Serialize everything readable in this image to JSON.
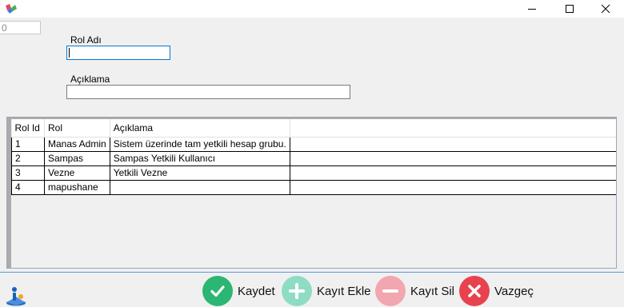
{
  "window": {
    "controls": [
      "minimize-icon",
      "maximize-icon",
      "close-icon"
    ]
  },
  "form": {
    "id_value": "0",
    "rol_adi_label": "Rol Adı",
    "rol_adi_value": "",
    "aciklama_label": "Açıklama",
    "aciklama_value": ""
  },
  "grid": {
    "columns": [
      "Rol Id",
      "Rol",
      "Açıklama"
    ],
    "rows": [
      {
        "id": "1",
        "rol": "Manas Admin",
        "aciklama": "Sistem üzerinde tam yetkili hesap grubu."
      },
      {
        "id": "2",
        "rol": "Sampas",
        "aciklama": "Sampas Yetkili Kullanıcı"
      },
      {
        "id": "3",
        "rol": "Vezne",
        "aciklama": "Yetkili Vezne"
      },
      {
        "id": "4",
        "rol": "mapushane",
        "aciklama": ""
      }
    ]
  },
  "actions": {
    "save": {
      "label": "Kaydet",
      "icon": "check-icon",
      "color": "#2bb673"
    },
    "add": {
      "label": "Kayıt Ekle",
      "icon": "plus-icon",
      "color": "#8fdcc4"
    },
    "delete": {
      "label": "Kayıt Sil",
      "icon": "minus-icon",
      "color": "#f2a6b0"
    },
    "cancel": {
      "label": "Vazgeç",
      "icon": "x-icon",
      "color": "#e8424f"
    }
  }
}
